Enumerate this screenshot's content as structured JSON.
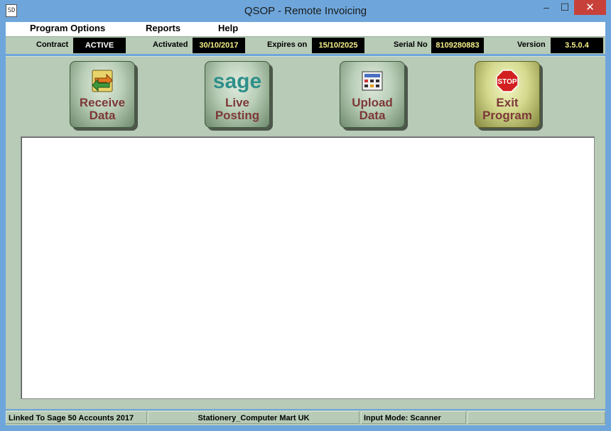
{
  "window": {
    "title": "QSOP - Remote Invoicing",
    "icon_text": "SD",
    "min_glyph": "–",
    "max_glyph": "☐",
    "close_glyph": "✕"
  },
  "menu": {
    "items": [
      {
        "label": "Program Options"
      },
      {
        "label": "Reports"
      },
      {
        "label": "Help"
      }
    ]
  },
  "info": {
    "contract_label": "Contract",
    "contract_value": "ACTIVE",
    "activated_label": "Activated",
    "activated_value": "30/10/2017",
    "expires_label": "Expires on",
    "expires_value": "15/10/2025",
    "serial_label": "Serial No",
    "serial_value": "8109280883",
    "version_label": "Version",
    "version_value": "3.5.0.4"
  },
  "toolbar": {
    "buttons": [
      {
        "line1": "Receive",
        "line2": "Data",
        "icon": "receive-arrows-icon"
      },
      {
        "line1": "Live",
        "line2": "Posting",
        "icon": "sage-logo-icon",
        "logo_text": "sage"
      },
      {
        "line1": "Upload",
        "line2": "Data",
        "icon": "upload-calculator-icon"
      },
      {
        "line1": "Exit",
        "line2": "Program",
        "icon": "stop-sign-icon",
        "sign_text": "STOP"
      }
    ]
  },
  "status": {
    "linked": "Linked To Sage 50 Accounts 2017",
    "company": "Stationery_Computer Mart UK",
    "input_mode": "Input Mode: Scanner",
    "extra": ""
  },
  "colors": {
    "titlebar": "#6ea6db",
    "panel": "#b7cbb6",
    "button_text": "#7d3838",
    "close": "#c7413a"
  }
}
